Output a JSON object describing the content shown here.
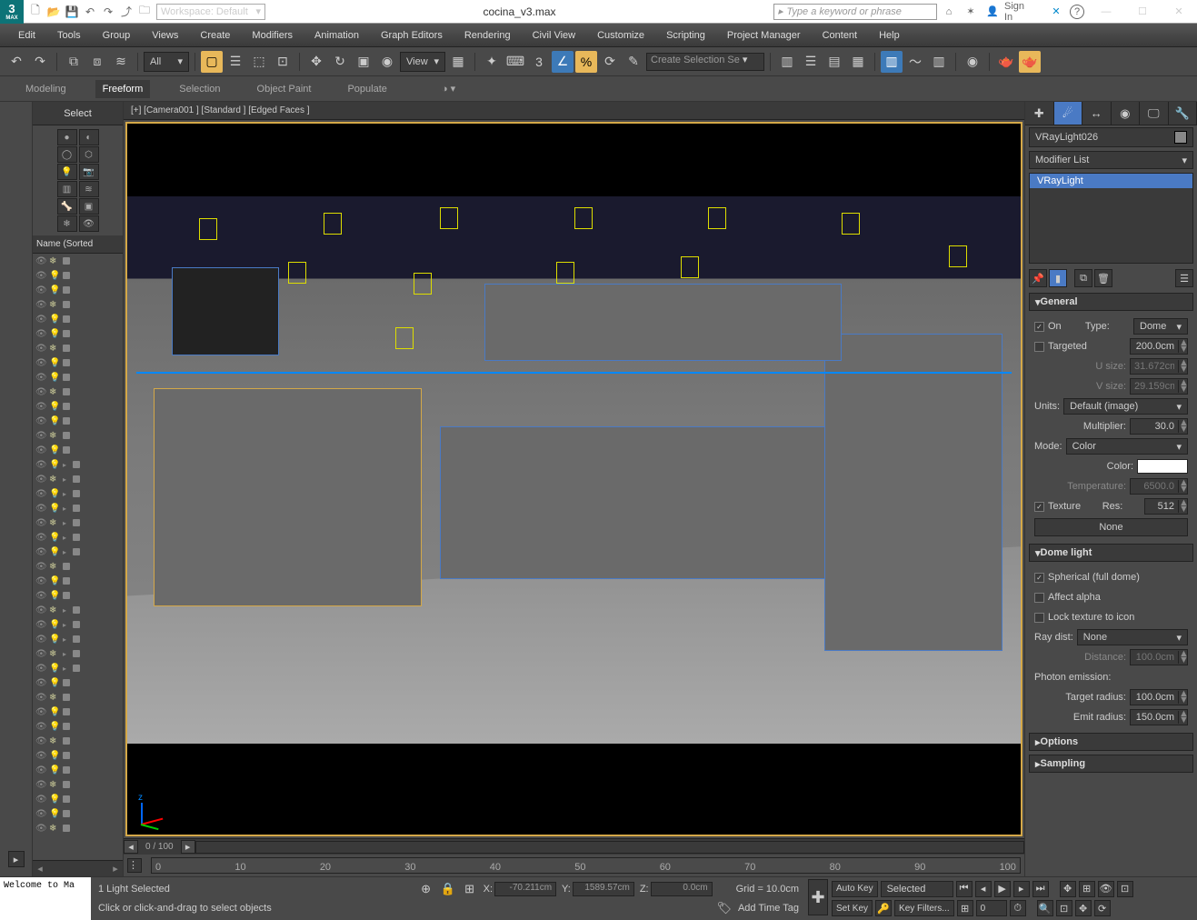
{
  "title": {
    "filename": "cocina_v3.max",
    "workspace": "Workspace: Default",
    "search_placeholder": "Type a keyword or phrase",
    "signin": "Sign In"
  },
  "winctrl": {
    "min": "—",
    "max": "☐",
    "close": "✕"
  },
  "menubar": [
    "Edit",
    "Tools",
    "Group",
    "Views",
    "Create",
    "Modifiers",
    "Animation",
    "Graph Editors",
    "Rendering",
    "Civil View",
    "Customize",
    "Scripting",
    "Project Manager",
    "Content",
    "Help"
  ],
  "toolbar1": {
    "filter": "All",
    "view": "View",
    "selset": "Create Selection Se"
  },
  "toolbar2": {
    "items": [
      "Modeling",
      "Freeform",
      "Selection",
      "Object Paint",
      "Populate"
    ],
    "active": 1
  },
  "select_panel": {
    "title": "Select",
    "name_header": "Name (Sorted"
  },
  "viewport": {
    "label": "[+] [Camera001 ] [Standard ] [Edged Faces ]",
    "axis_z": "z",
    "frame": "0 / 100"
  },
  "timeline": {
    "ticks": [
      "0",
      "10",
      "20",
      "30",
      "40",
      "50",
      "60",
      "70",
      "80",
      "90",
      "100"
    ]
  },
  "rightpanel": {
    "object_name": "VRayLight026",
    "mod_list": "Modifier List",
    "mod_entry": "VRayLight",
    "general": {
      "title": "General",
      "on": "On",
      "type": "Type:",
      "type_val": "Dome",
      "targeted": "Targeted",
      "targeted_val": "200.0cm",
      "usize": "U size:",
      "usize_val": "31.672cm",
      "vsize": "V size:",
      "vsize_val": "29.159cm",
      "units": "Units:",
      "units_val": "Default (image)",
      "mult": "Multiplier:",
      "mult_val": "30.0",
      "mode": "Mode:",
      "mode_val": "Color",
      "color": "Color:",
      "temp": "Temperature:",
      "temp_val": "6500.0",
      "texture": "Texture",
      "res": "Res:",
      "res_val": "512",
      "none_btn": "None"
    },
    "dome": {
      "title": "Dome light",
      "spherical": "Spherical (full dome)",
      "affect": "Affect alpha",
      "lock": "Lock texture to icon",
      "raydist": "Ray dist:",
      "raydist_val": "None",
      "distance": "Distance:",
      "distance_val": "100.0cm",
      "photon": "Photon emission:",
      "target_r": "Target radius:",
      "target_r_val": "100.0cm",
      "emit_r": "Emit radius:",
      "emit_r_val": "150.0cm"
    },
    "options": "Options",
    "sampling": "Sampling"
  },
  "statusbar": {
    "welcome": "Welcome to Ma",
    "sel_status": "1 Light Selected",
    "prompt": "Click or click-and-drag to select objects",
    "x": "X:",
    "x_val": "-70.211cm",
    "y": "Y:",
    "y_val": "1589.57cm",
    "z": "Z:",
    "z_val": "0.0cm",
    "grid": "Grid = 10.0cm",
    "addtime": "Add Time Tag",
    "autokey": "Auto Key",
    "selected": "Selected",
    "setkey": "Set Key",
    "keyfilters": "Key Filters..."
  }
}
